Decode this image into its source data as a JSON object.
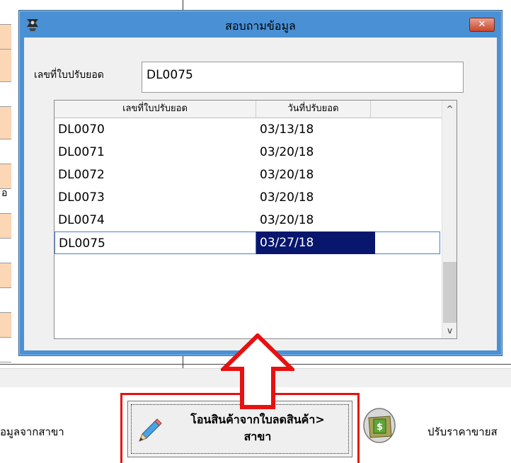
{
  "dialog": {
    "title": "สอบถามข้อมูล",
    "close_label": "✕",
    "field_label": "เลขที่ใบปรับยอด",
    "field_value": "DL0075"
  },
  "grid": {
    "columns": [
      "เลขที่ใบปรับยอด",
      "วันที่ปรับยอด"
    ],
    "rows": [
      {
        "doc": "DL0070",
        "date": "03/13/18"
      },
      {
        "doc": "DL0071",
        "date": "03/20/18"
      },
      {
        "doc": "DL0072",
        "date": "03/20/18"
      },
      {
        "doc": "DL0073",
        "date": "03/20/18"
      },
      {
        "doc": "DL0074",
        "date": "03/20/18"
      },
      {
        "doc": "DL0075",
        "date": "03/27/18"
      }
    ],
    "selected_doc": "DL0075",
    "scroll_up": "^",
    "scroll_down": "v"
  },
  "background": {
    "left_label": "อมูลจากสาขา",
    "left_tail": "อ",
    "transfer_button": {
      "line1": "โอนสินค้าจากใบลดสินค้า>",
      "line2": "สาขา"
    },
    "right_label": "ปรับราคาขายส"
  },
  "colors": {
    "title_bar": "#4a90d4",
    "selection": "#08166d",
    "highlight_frame": "#e81010",
    "arrow": "#e81010",
    "peach": "#fbd7b5"
  },
  "icons": [
    "app-icon",
    "close-icon",
    "pencil-icon",
    "money-folder-icon",
    "up-arrow-icon"
  ]
}
